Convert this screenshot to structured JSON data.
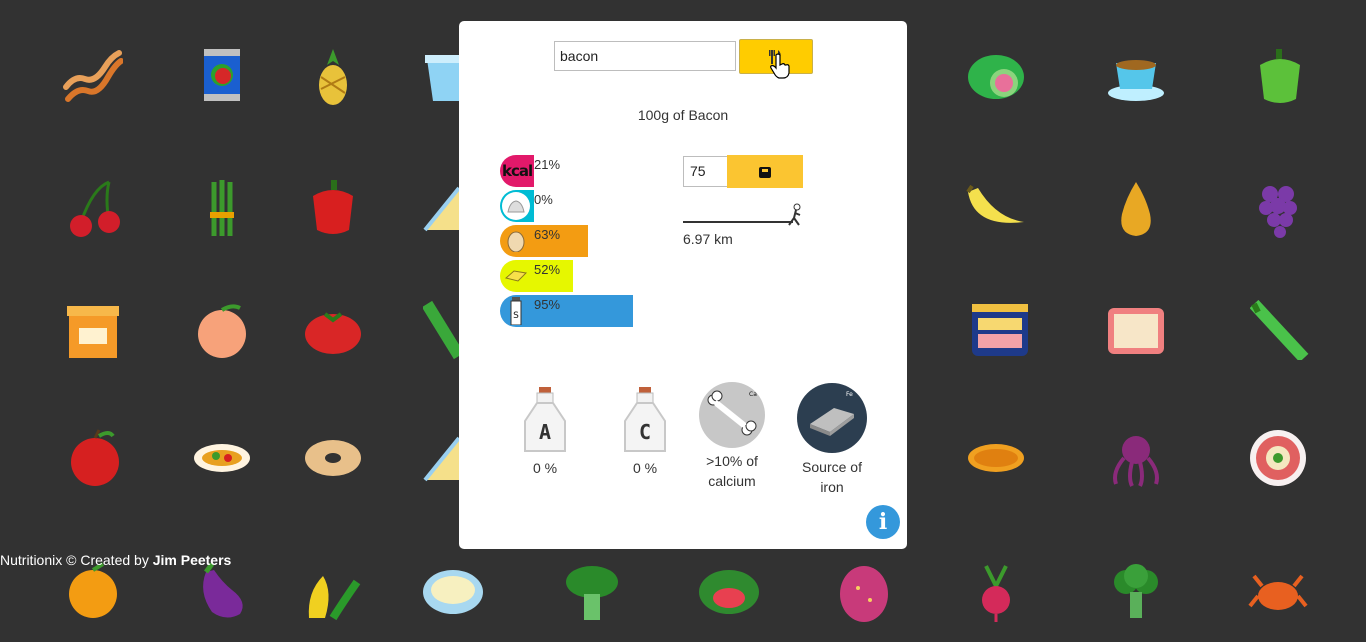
{
  "search": {
    "value": "bacon",
    "button_icon": "fork-knife-icon"
  },
  "portion_text": "100g of Bacon",
  "nutrients": [
    {
      "name": "kcal",
      "icon": "kcal-icon",
      "label": "kcal",
      "percent": 21,
      "percent_text": "21%",
      "color": "#e2196a"
    },
    {
      "name": "sugar",
      "icon": "sugar-icon",
      "label": "",
      "percent": 0,
      "percent_text": "0%",
      "color": "#00bcd4"
    },
    {
      "name": "protein",
      "icon": "egg-icon",
      "label": "",
      "percent": 63,
      "percent_text": "63%",
      "color": "#f39c12"
    },
    {
      "name": "fat",
      "icon": "butter-icon",
      "label": "",
      "percent": 52,
      "percent_text": "52%",
      "color": "#e6f700"
    },
    {
      "name": "salt",
      "icon": "salt-shaker-icon",
      "label": "",
      "percent": 95,
      "percent_text": "95%",
      "color": "#3498db"
    }
  ],
  "quantity": {
    "value": "75",
    "unit_icon": "scale-icon"
  },
  "exercise": {
    "distance": "6.97 km",
    "icon": "walking-figure-icon"
  },
  "vitamins": [
    {
      "name": "vitamin-a",
      "letter": "A",
      "text": "0 %"
    },
    {
      "name": "vitamin-c",
      "letter": "C",
      "text": "0 %"
    }
  ],
  "minerals": [
    {
      "name": "calcium",
      "symbol": "Ca",
      "line1": ">10% of",
      "line2": "calcium",
      "color": "#c7c7c7"
    },
    {
      "name": "iron",
      "symbol": "Fe",
      "line1": "Source of",
      "line2": "iron",
      "color": "#2c3e50"
    }
  ],
  "info_label": "i",
  "footer": {
    "prefix": "Nutritionix © Created by ",
    "author": "Jim Peeters"
  },
  "background_foods": [
    "bacon",
    "canned-tomatoes",
    "pineapple",
    "yogurt",
    "lime",
    "tea-cup",
    "bell-pepper-green",
    "cherries",
    "asparagus",
    "red-pepper",
    "cheese",
    "banana",
    "pear",
    "grapes",
    "jar",
    "peach",
    "tomato",
    "celery-stick",
    "spam",
    "candy-box",
    "celery",
    "apple",
    "salad-plate",
    "bagel",
    "cheese-wedge",
    "fried-food",
    "octopus",
    "sushi-plate",
    "orange",
    "eggplant",
    "peppers",
    "rice-plate",
    "spinach",
    "watermelon",
    "dragonfruit",
    "radish",
    "broccoli",
    "crab"
  ],
  "colors": {
    "accent": "#ffcc00",
    "background": "#323232",
    "info": "#3498db"
  }
}
